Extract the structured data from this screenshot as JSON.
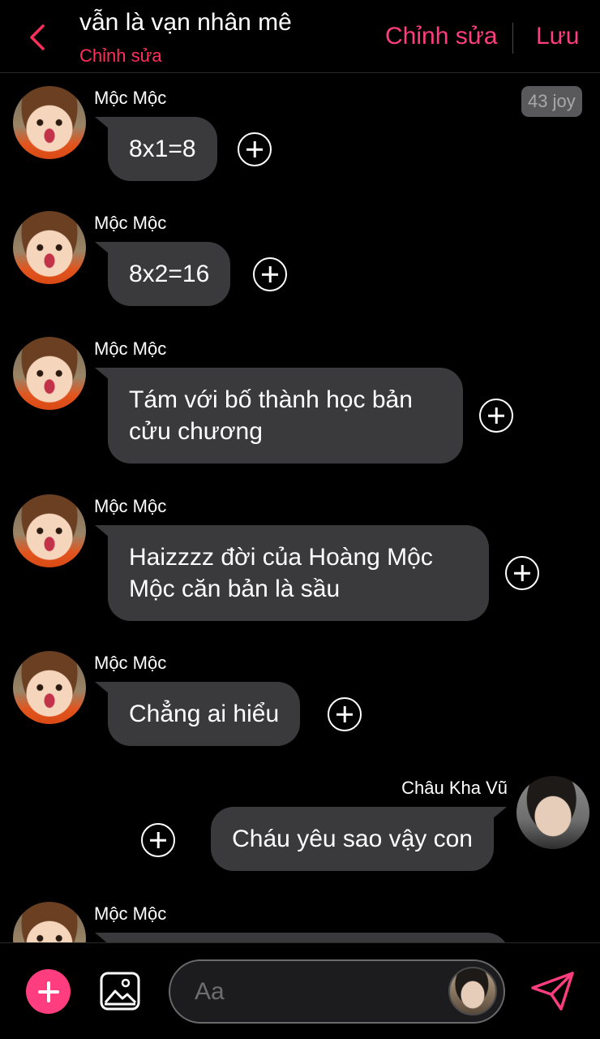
{
  "header": {
    "title": "vẫn là vạn nhân mê",
    "subtitle": "Chỉnh sửa",
    "edit_label": "Chỉnh sửa",
    "save_label": "Lưu"
  },
  "joy_badge": "43 joy",
  "messages": [
    {
      "sender": "Mộc Mộc",
      "text": "8x1=8",
      "direction": "in"
    },
    {
      "sender": "Mộc Mộc",
      "text": "8x2=16",
      "direction": "in"
    },
    {
      "sender": "Mộc Mộc",
      "text": "Tám với bố thành học bản cửu chương",
      "direction": "in"
    },
    {
      "sender": "Mộc Mộc",
      "text": "Haizzzz đời của Hoàng Mộc Mộc căn bản là sầu",
      "direction": "in"
    },
    {
      "sender": "Mộc Mộc",
      "text": "Chẳng ai hiểu",
      "direction": "in"
    },
    {
      "sender": "Châu Kha Vũ",
      "text": "Cháu yêu sao vậy con",
      "direction": "out"
    },
    {
      "sender": "Mộc Mộc",
      "text": "",
      "direction": "in"
    }
  ],
  "composer": {
    "placeholder": "Aa"
  },
  "colors": {
    "accent": "#ff3d7f",
    "subtitle": "#ff2e5a",
    "bubble": "#3a3a3c",
    "background": "#000000"
  },
  "icons": {
    "back": "chevron-left-icon",
    "add": "plus-icon",
    "image": "image-icon",
    "send": "send-icon",
    "react": "add-reaction-icon"
  }
}
